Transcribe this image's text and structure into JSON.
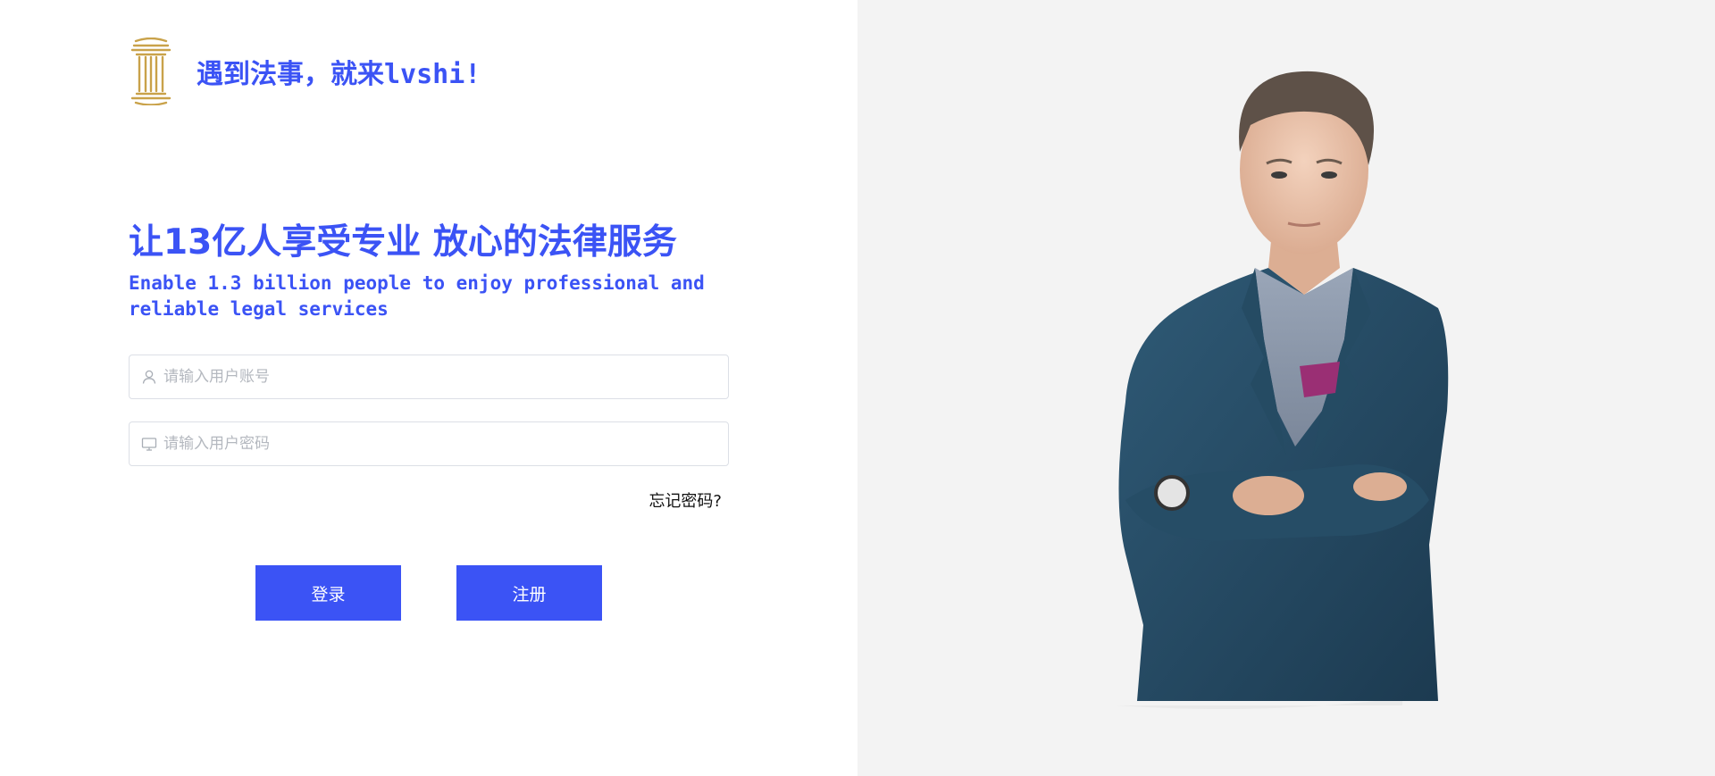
{
  "brand": {
    "logo_icon": "pillar-logo-icon",
    "title": "遇到法事，就来lvshi!",
    "accent_color": "#3b53f5",
    "logo_color": "#c9a24a"
  },
  "hero": {
    "headline": "让13亿人享受专业 放心的法律服务",
    "subline": "Enable 1.3 billion people to enjoy professional and reliable legal services"
  },
  "login_form": {
    "username": {
      "icon": "user-icon",
      "placeholder": "请输入用户账号",
      "value": ""
    },
    "password": {
      "icon": "monitor-icon",
      "placeholder": "请输入用户密码",
      "value": ""
    },
    "forgot_label": "忘记密码?",
    "login_label": "登录",
    "register_label": "注册"
  },
  "side_image": {
    "description_icon": "businessman-portrait",
    "background_color": "#f3f3f3"
  }
}
